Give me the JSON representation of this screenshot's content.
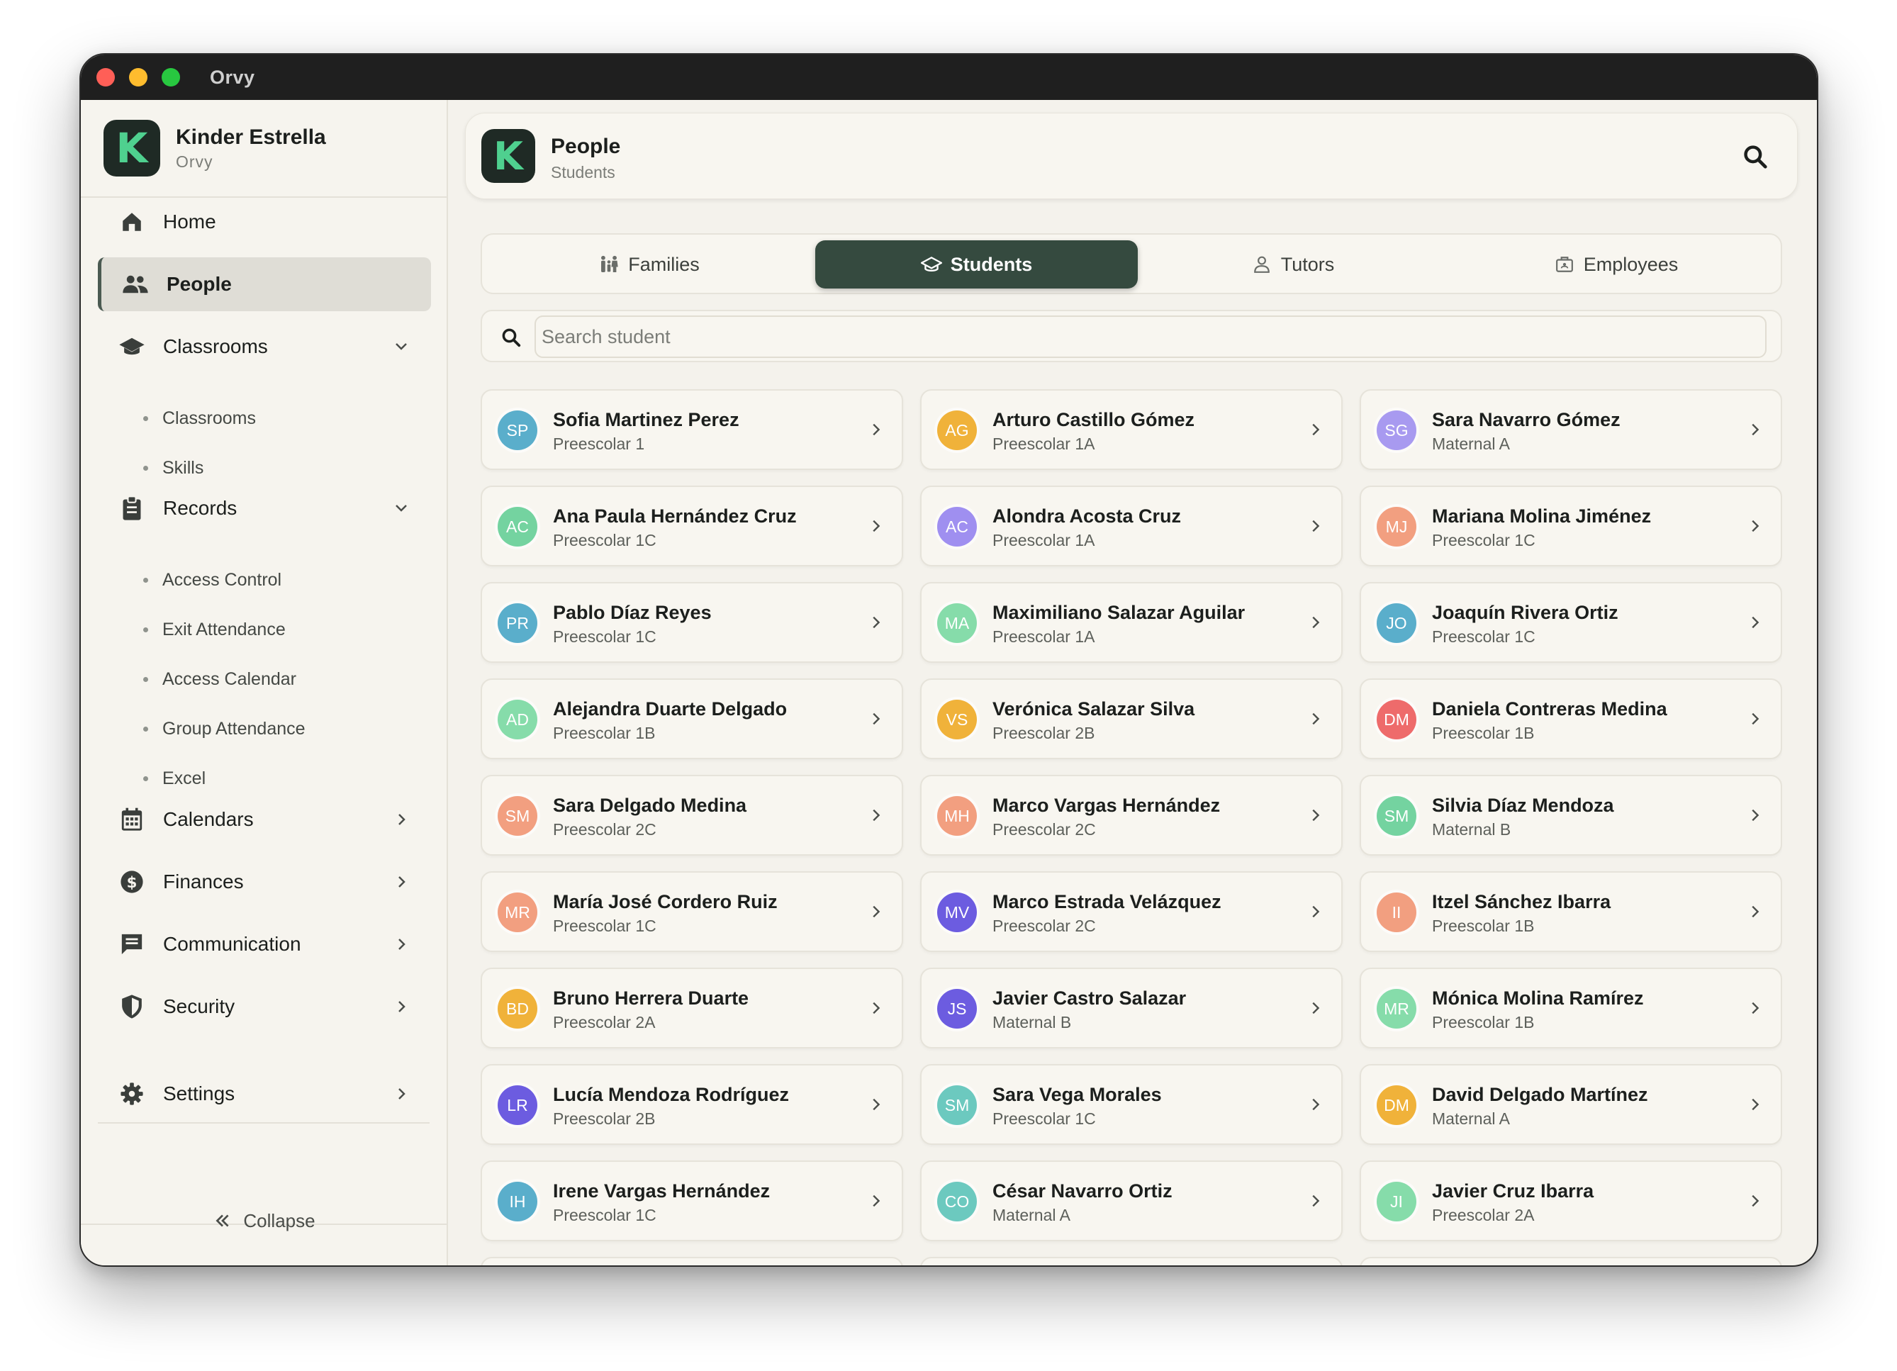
{
  "window": {
    "title": "Orvy"
  },
  "brand": {
    "name": "Kinder Estrella",
    "sub": "Orvy",
    "logo_letter": "K",
    "logo_color": "#4fd08f"
  },
  "nav": {
    "home": "Home",
    "people": "People",
    "classrooms": "Classrooms",
    "classrooms_sub": [
      "Classrooms",
      "Skills"
    ],
    "records": "Records",
    "records_sub": [
      "Access Control",
      "Exit Attendance",
      "Access Calendar",
      "Group Attendance",
      "Excel"
    ],
    "calendars": "Calendars",
    "finances": "Finances",
    "communication": "Communication",
    "security": "Security",
    "settings": "Settings",
    "collapse": "Collapse"
  },
  "header": {
    "title": "People",
    "subtitle": "Students"
  },
  "tabs": [
    {
      "label": "Families",
      "icon": "family-icon",
      "active": false
    },
    {
      "label": "Students",
      "icon": "graduation-cap-icon",
      "active": true
    },
    {
      "label": "Tutors",
      "icon": "person-icon",
      "active": false
    },
    {
      "label": "Employees",
      "icon": "briefcase-icon",
      "active": false
    }
  ],
  "search": {
    "placeholder": "Search student",
    "value": ""
  },
  "students": [
    {
      "initials": "SP",
      "name": "Sofia Martinez Perez",
      "group": "Preescolar 1",
      "color": "#5aaecb"
    },
    {
      "initials": "AG",
      "name": "Arturo Castillo Gómez",
      "group": "Preescolar 1A",
      "color": "#f0b23a"
    },
    {
      "initials": "SG",
      "name": "Sara Navarro Gómez",
      "group": "Maternal A",
      "color": "#a89af0"
    },
    {
      "initials": "AC",
      "name": "Ana Paula Hernández Cruz",
      "group": "Preescolar 1C",
      "color": "#74d3a0"
    },
    {
      "initials": "AC",
      "name": "Alondra Acosta Cruz",
      "group": "Preescolar 1A",
      "color": "#9f8ff0"
    },
    {
      "initials": "MJ",
      "name": "Mariana Molina Jiménez",
      "group": "Preescolar 1C",
      "color": "#f29f80"
    },
    {
      "initials": "PR",
      "name": "Pablo Díaz Reyes",
      "group": "Preescolar 1C",
      "color": "#5aaecb"
    },
    {
      "initials": "MA",
      "name": "Maximiliano Salazar Aguilar",
      "group": "Preescolar 1A",
      "color": "#86dcaa"
    },
    {
      "initials": "JO",
      "name": "Joaquín Rivera Ortiz",
      "group": "Preescolar 1C",
      "color": "#5aaecb"
    },
    {
      "initials": "AD",
      "name": "Alejandra Duarte Delgado",
      "group": "Preescolar 1B",
      "color": "#86dcaa"
    },
    {
      "initials": "VS",
      "name": "Verónica Salazar Silva",
      "group": "Preescolar 2B",
      "color": "#f0b23a"
    },
    {
      "initials": "DM",
      "name": "Daniela Contreras Medina",
      "group": "Preescolar 1B",
      "color": "#ee6b6b"
    },
    {
      "initials": "SM",
      "name": "Sara Delgado Medina",
      "group": "Preescolar 2C",
      "color": "#f29f80"
    },
    {
      "initials": "MH",
      "name": "Marco Vargas Hernández",
      "group": "Preescolar 2C",
      "color": "#f29f80"
    },
    {
      "initials": "SM",
      "name": "Silvia Díaz Mendoza",
      "group": "Maternal B",
      "color": "#74d3a0"
    },
    {
      "initials": "MR",
      "name": "María José Cordero Ruiz",
      "group": "Preescolar 1C",
      "color": "#f29f80"
    },
    {
      "initials": "MV",
      "name": "Marco Estrada Velázquez",
      "group": "Preescolar 2C",
      "color": "#6c5ce0"
    },
    {
      "initials": "II",
      "name": "Itzel Sánchez Ibarra",
      "group": "Preescolar 1B",
      "color": "#f29f80"
    },
    {
      "initials": "BD",
      "name": "Bruno Herrera Duarte",
      "group": "Preescolar 2A",
      "color": "#f0b23a"
    },
    {
      "initials": "JS",
      "name": "Javier Castro Salazar",
      "group": "Maternal B",
      "color": "#6c5ce0"
    },
    {
      "initials": "MR",
      "name": "Mónica Molina Ramírez",
      "group": "Preescolar 1B",
      "color": "#86dcaa"
    },
    {
      "initials": "LR",
      "name": "Lucía Mendoza Rodríguez",
      "group": "Preescolar 2B",
      "color": "#6c5ce0"
    },
    {
      "initials": "SM",
      "name": "Sara Vega Morales",
      "group": "Preescolar 1C",
      "color": "#6cc9bf"
    },
    {
      "initials": "DM",
      "name": "David Delgado Martínez",
      "group": "Maternal A",
      "color": "#f0b23a"
    },
    {
      "initials": "IH",
      "name": "Irene Vargas Hernández",
      "group": "Preescolar 1C",
      "color": "#5aaecb"
    },
    {
      "initials": "CO",
      "name": "César Navarro Ortiz",
      "group": "Maternal A",
      "color": "#6cc9bf"
    },
    {
      "initials": "JI",
      "name": "Javier Cruz Ibarra",
      "group": "Preescolar 2A",
      "color": "#86dcaa"
    }
  ]
}
